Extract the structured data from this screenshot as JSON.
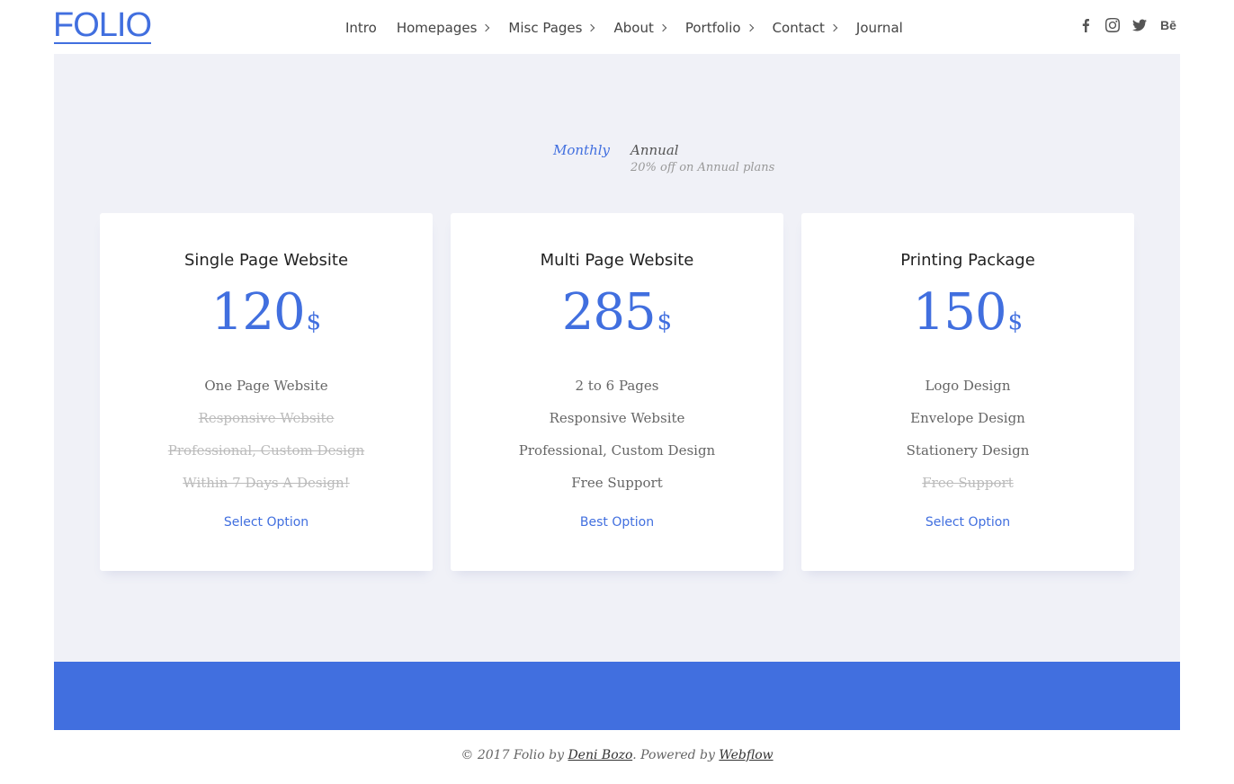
{
  "brand": {
    "logo": "FOLIO"
  },
  "nav": [
    {
      "label": "Intro",
      "has_children": false
    },
    {
      "label": "Homepages",
      "has_children": true
    },
    {
      "label": "Misc Pages",
      "has_children": true
    },
    {
      "label": "About",
      "has_children": true
    },
    {
      "label": "Portfolio",
      "has_children": true
    },
    {
      "label": "Contact",
      "has_children": true
    },
    {
      "label": "Journal",
      "has_children": false
    }
  ],
  "socials": [
    "facebook-icon",
    "instagram-icon",
    "twitter-icon",
    "behance-icon"
  ],
  "behance_label": "Bē",
  "pricing_toggle": {
    "monthly": "Monthly",
    "annual": "Annual",
    "annual_note": "20% off on Annual plans"
  },
  "plans": [
    {
      "title": "Single Page Website",
      "price": "120",
      "currency": "$",
      "features": [
        {
          "text": "One Page Website",
          "included": true
        },
        {
          "text": "Responsive Website",
          "included": false
        },
        {
          "text": "Professional, Custom Design",
          "included": false
        },
        {
          "text": "Within 7 Days A Design!",
          "included": false
        }
      ],
      "cta": "Select Option"
    },
    {
      "title": "Multi Page Website",
      "price": "285",
      "currency": "$",
      "features": [
        {
          "text": "2 to 6 Pages",
          "included": true
        },
        {
          "text": "Responsive Website",
          "included": true
        },
        {
          "text": "Professional, Custom Design",
          "included": true
        },
        {
          "text": "Free Support",
          "included": true
        }
      ],
      "cta": "Best Option"
    },
    {
      "title": "Printing Package",
      "price": "150",
      "currency": "$",
      "features": [
        {
          "text": "Logo Design",
          "included": true
        },
        {
          "text": "Envelope Design",
          "included": true
        },
        {
          "text": "Stationery Design",
          "included": true
        },
        {
          "text": "Free Support",
          "included": false
        }
      ],
      "cta": "Select Option"
    }
  ],
  "footer": {
    "prefix": "© 2017 Folio by ",
    "author": "Deni Bozo",
    "middle": ". Powered by ",
    "platform": "Webflow"
  },
  "colors": {
    "accent": "#416fdf",
    "background": "#f0f1f7"
  }
}
